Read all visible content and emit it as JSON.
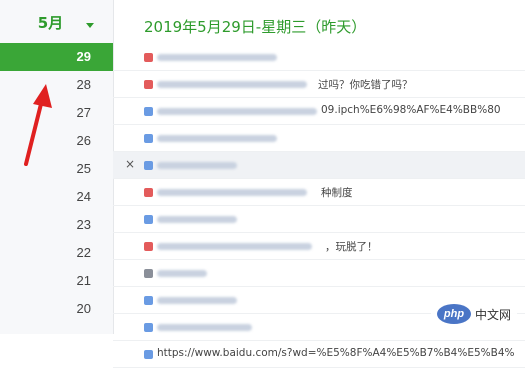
{
  "sidebar": {
    "month": "5月",
    "days": [
      "29",
      "28",
      "27",
      "26",
      "25",
      "24",
      "23",
      "22",
      "21",
      "20"
    ],
    "active_day": "29"
  },
  "main": {
    "date_title": "2019年5月29日-星期三（昨天）",
    "rows": [
      {
        "favicon": "red",
        "clear": ""
      },
      {
        "favicon": "red",
        "clear": "过吗？你吃错了吗？"
      },
      {
        "favicon": "blue",
        "clear": "09.ipch%E6%98%AF%E4%BB%80"
      },
      {
        "favicon": "blue",
        "clear": ""
      },
      {
        "favicon": "blue",
        "clear": "",
        "hover": true
      },
      {
        "favicon": "red",
        "clear": "种制度"
      },
      {
        "favicon": "blue",
        "clear": ""
      },
      {
        "favicon": "red",
        "clear": "，玩脱了！"
      },
      {
        "favicon": "gray",
        "clear": ""
      },
      {
        "favicon": "blue",
        "clear": ""
      },
      {
        "favicon": "blue",
        "clear": ""
      },
      {
        "favicon": "blue",
        "clear": "https://www.baidu.com/s?wd=%E5%8F%A4%E5%B7%B4%E5%B4%"
      }
    ]
  },
  "close_glyph": "×",
  "watermark": {
    "logo": "php",
    "text": "中文网"
  }
}
